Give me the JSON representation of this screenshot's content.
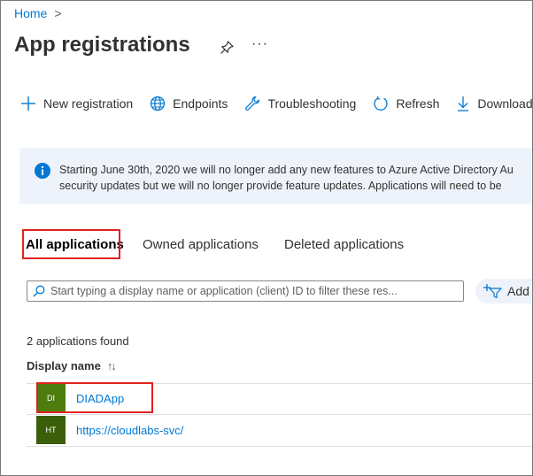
{
  "breadcrumb": {
    "home": "Home",
    "separator": ">"
  },
  "page": {
    "title": "App registrations",
    "pin_icon": "pin-icon",
    "more": "···"
  },
  "toolbar": {
    "new_registration": "New registration",
    "endpoints": "Endpoints",
    "troubleshooting": "Troubleshooting",
    "refresh": "Refresh",
    "download": "Download"
  },
  "banner": {
    "line1": "Starting June 30th, 2020 we will no longer add any new features to Azure Active Directory Au",
    "line2": "security updates but we will no longer provide feature updates. Applications will need to be"
  },
  "tabs": {
    "all": "All applications",
    "owned": "Owned applications",
    "deleted": "Deleted applications"
  },
  "search": {
    "placeholder": "Start typing a display name or application (client) ID to filter these res...",
    "filter_label": "Add"
  },
  "results": {
    "count_text": "2 applications found",
    "column_display_name": "Display name",
    "sort_glyph": "↑↓",
    "apps": [
      {
        "initials": "DI",
        "name": "DIADApp",
        "avatar_color": "#4e7d0f"
      },
      {
        "initials": "HT",
        "name": "https://cloudlabs-svc/",
        "avatar_color": "#3b5e0a"
      }
    ]
  },
  "colors": {
    "accent": "#0078d4",
    "highlight": "#e0231f",
    "banner_bg": "#eef3fb"
  }
}
